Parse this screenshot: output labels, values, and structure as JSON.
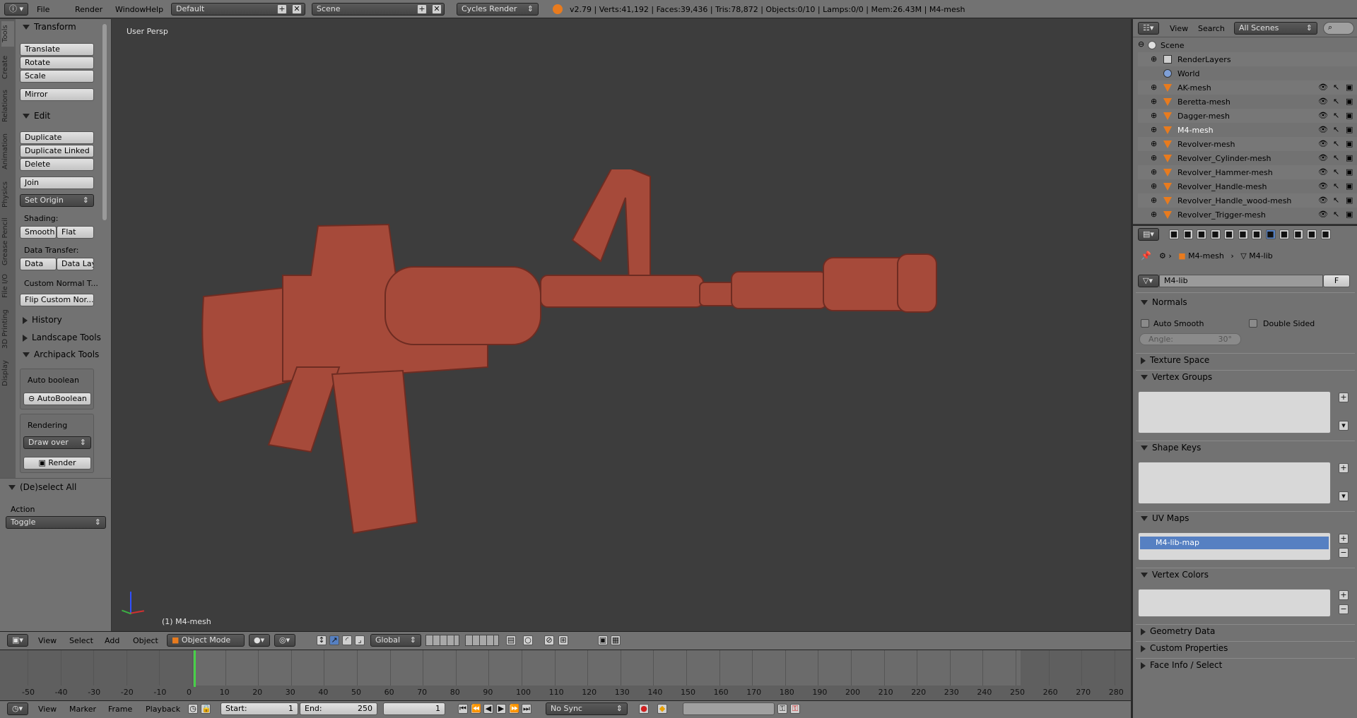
{
  "topbar": {
    "menus": [
      "File",
      "Render",
      "Window",
      "Help"
    ],
    "layout": "Default",
    "scene": "Scene",
    "engine": "Cycles Render",
    "stats": "v2.79 | Verts:41,192 | Faces:39,436 | Tris:78,872 | Objects:0/10 | Lamps:0/0 | Mem:26.43M | M4-mesh"
  },
  "vtabs": [
    "Tools",
    "Create",
    "Relations",
    "Animation",
    "Physics",
    "Grease Pencil",
    "File I/O",
    "3D Printing",
    "Display"
  ],
  "toolshelf": {
    "transform_title": "Transform",
    "translate": "Translate",
    "rotate": "Rotate",
    "scale": "Scale",
    "mirror": "Mirror",
    "edit_title": "Edit",
    "duplicate": "Duplicate",
    "duplicate_linked": "Duplicate Linked",
    "delete": "Delete",
    "join": "Join",
    "set_origin": "Set Origin",
    "shading_label": "Shading:",
    "smooth": "Smooth",
    "flat": "Flat",
    "data_transfer_label": "Data Transfer:",
    "data": "Data",
    "data_lay": "Data Lay",
    "custom_normal": "Custom Normal T...",
    "flip_custom": "Flip Custom Nor...",
    "history": "History",
    "landscape": "Landscape Tools",
    "archipack": "Archipack Tools",
    "auto_boolean_label": "Auto boolean",
    "auto_boolean_btn": "AutoBoolean",
    "rendering_label": "Rendering",
    "draw_over": "Draw over",
    "render_btn": "Render"
  },
  "operator": {
    "title": "(De)select All",
    "action_label": "Action",
    "action_value": "Toggle"
  },
  "viewport": {
    "persp": "User Persp",
    "object_label": "(1) M4-mesh",
    "model_color": "#a64a3a"
  },
  "viewport_header": {
    "menus": [
      "View",
      "Select",
      "Add",
      "Object"
    ],
    "mode": "Object Mode",
    "orientation": "Global"
  },
  "timeline": {
    "ticks": [
      "-50",
      "-40",
      "-30",
      "-20",
      "-10",
      "0",
      "10",
      "20",
      "30",
      "40",
      "50",
      "60",
      "70",
      "80",
      "90",
      "100",
      "110",
      "120",
      "130",
      "140",
      "150",
      "160",
      "170",
      "180",
      "190",
      "200",
      "210",
      "220",
      "230",
      "240",
      "250",
      "260",
      "270",
      "280"
    ],
    "menus": [
      "View",
      "Marker",
      "Frame",
      "Playback"
    ],
    "start_label": "Start:",
    "start_value": "1",
    "end_label": "End:",
    "end_value": "250",
    "current": "1",
    "sync": "No Sync"
  },
  "outliner": {
    "menus": [
      "View",
      "Search"
    ],
    "scope": "All Scenes",
    "scene": "Scene",
    "items": [
      {
        "label": "RenderLayers",
        "type": "renderlayers"
      },
      {
        "label": "World",
        "type": "world"
      },
      {
        "label": "AK-mesh",
        "type": "mesh"
      },
      {
        "label": "Beretta-mesh",
        "type": "mesh"
      },
      {
        "label": "Dagger-mesh",
        "type": "mesh"
      },
      {
        "label": "M4-mesh",
        "type": "mesh"
      },
      {
        "label": "Revolver-mesh",
        "type": "mesh"
      },
      {
        "label": "Revolver_Cylinder-mesh",
        "type": "mesh"
      },
      {
        "label": "Revolver_Hammer-mesh",
        "type": "mesh"
      },
      {
        "label": "Revolver_Handle-mesh",
        "type": "mesh"
      },
      {
        "label": "Revolver_Handle_wood-mesh",
        "type": "mesh"
      },
      {
        "label": "Revolver_Trigger-mesh",
        "type": "mesh"
      }
    ]
  },
  "properties": {
    "breadcrumb_object": "M4-mesh",
    "breadcrumb_data": "M4-lib",
    "datablock_name": "M4-lib",
    "datablock_fake": "F",
    "normals": "Normals",
    "auto_smooth": "Auto Smooth",
    "double_sided": "Double Sided",
    "angle": "Angle:",
    "angle_value": "30°",
    "texture_space": "Texture Space",
    "vertex_groups": "Vertex Groups",
    "shape_keys": "Shape Keys",
    "uv_maps": "UV Maps",
    "uv_map_item": "M4-lib-map",
    "vertex_colors": "Vertex Colors",
    "geometry_data": "Geometry Data",
    "custom_properties": "Custom Properties",
    "face_info": "Face Info / Select"
  }
}
